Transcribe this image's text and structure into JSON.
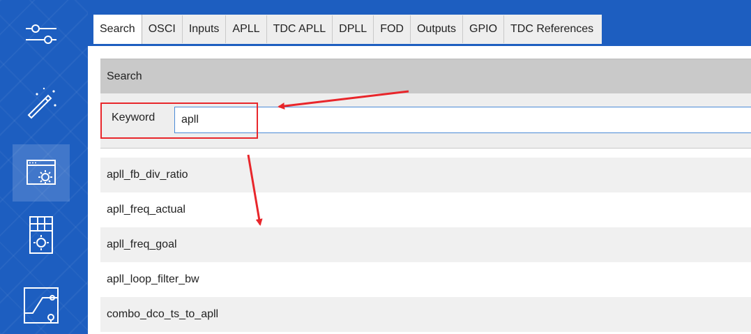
{
  "tabs": [
    {
      "label": "Search",
      "active": true
    },
    {
      "label": "OSCI"
    },
    {
      "label": "Inputs"
    },
    {
      "label": "APLL"
    },
    {
      "label": "TDC APLL"
    },
    {
      "label": "DPLL"
    },
    {
      "label": "FOD"
    },
    {
      "label": "Outputs"
    },
    {
      "label": "GPIO"
    },
    {
      "label": "TDC References"
    }
  ],
  "sidebar": {
    "items": [
      {
        "icon": "sliders-icon"
      },
      {
        "icon": "magic-wand-icon"
      },
      {
        "icon": "window-settings-icon",
        "active": true
      },
      {
        "icon": "grid-settings-icon"
      },
      {
        "icon": "circuit-switch-icon"
      }
    ]
  },
  "search": {
    "header": "Search",
    "keyword_label": "Keyword",
    "keyword_value": "apll"
  },
  "results": [
    "apll_fb_div_ratio",
    "apll_freq_actual",
    "apll_freq_goal",
    "apll_loop_filter_bw",
    "combo_dco_ts_to_apll"
  ],
  "colors": {
    "rail": "#1d5ec0",
    "annotation": "#e8262b",
    "header": "#c9c9c9"
  }
}
